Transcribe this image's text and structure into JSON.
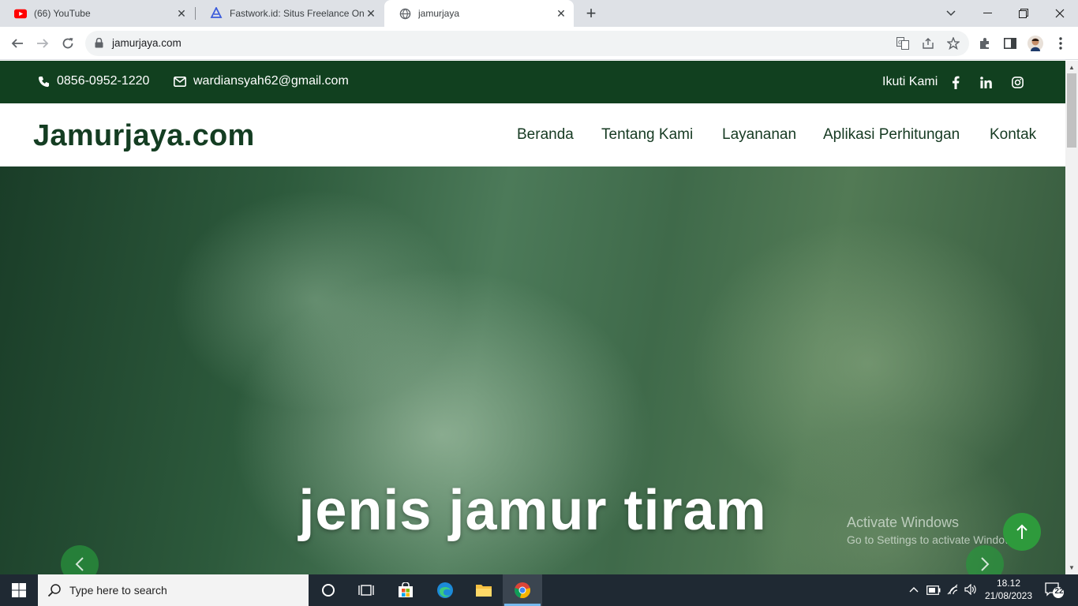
{
  "browser": {
    "tabs": [
      {
        "title": "(66) YouTube",
        "icon": "youtube-icon"
      },
      {
        "title": "Fastwork.id: Situs Freelance Online",
        "icon": "fastwork-icon"
      },
      {
        "title": "jamurjaya",
        "icon": "globe-icon",
        "active": true
      }
    ],
    "url": "jamurjaya.com"
  },
  "site": {
    "topbar": {
      "phone": "0856-0952-1220",
      "email": "wardiansyah62@gmail.com",
      "follow_label": "Ikuti Kami",
      "social": [
        "facebook-icon",
        "linkedin-icon",
        "instagram-icon"
      ]
    },
    "logo": "Jamurjaya.com",
    "menu": [
      "Beranda",
      "Tentang Kami",
      "Layananan",
      "Aplikasi Perhitungan",
      "Kontak"
    ],
    "hero": {
      "caption": "jenis jamur tiram"
    },
    "colors": {
      "brand_dark_green": "#11401f",
      "accent_green": "#2e9a3c"
    }
  },
  "watermark": {
    "line1": "Activate Windows",
    "line2": "Go to Settings to activate Windows."
  },
  "taskbar": {
    "search_placeholder": "Type here to search",
    "time": "18.12",
    "date": "21/08/2023",
    "notification_count": "22"
  }
}
